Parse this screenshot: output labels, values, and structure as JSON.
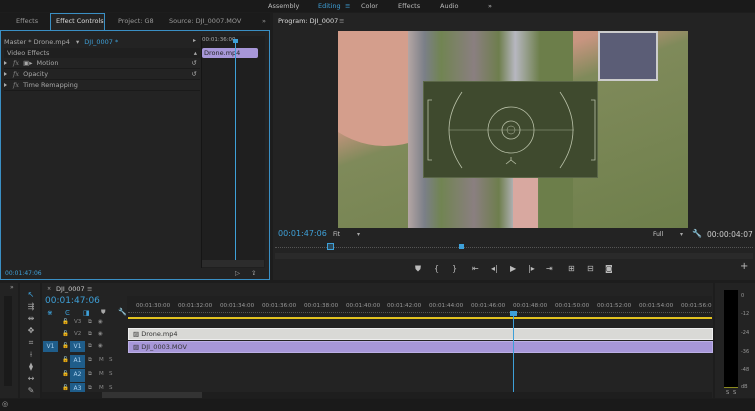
{
  "workspaces": {
    "items": [
      "Assembly",
      "Editing",
      "Color",
      "Effects",
      "Audio"
    ],
    "active": "Editing",
    "more": "»"
  },
  "tabs": {
    "effects": "Effects",
    "effect_controls": "Effect Controls",
    "project": "Project: G8",
    "source": "Source: DJI_0007.MOV",
    "more": "»",
    "program": "Program: DJI_0007"
  },
  "effect_controls": {
    "master": "Master * Drone.mp4",
    "sequence_clip": "DJI_0007 * Drone.mp4",
    "mini_time": "00:01:36:00",
    "mini_clip": "Drone.mp4",
    "section": "Video Effects",
    "effects": [
      "Motion",
      "Opacity",
      "Time Remapping"
    ],
    "timecode": "00:01:47:06"
  },
  "program": {
    "timecode": "00:01:47:06",
    "zoom": "Fit",
    "resolution": "Full",
    "duration": "00:00:04:07"
  },
  "timeline": {
    "sequence": "DJI_0007",
    "timecode": "00:01:47:06",
    "ruler": [
      "00:01:30:00",
      "00:01:32:00",
      "00:01:34:00",
      "00:01:36:00",
      "00:01:38:00",
      "00:01:40:00",
      "00:01:42:00",
      "00:01:44:00",
      "00:01:46:00",
      "00:01:48:00",
      "00:01:50:00",
      "00:01:52:00",
      "00:01:54:00",
      "00:01:56:0"
    ],
    "tracks": [
      {
        "label": "V3",
        "m": "",
        "s": ""
      },
      {
        "label": "V2",
        "m": "",
        "s": ""
      },
      {
        "label": "V1",
        "source": "V1",
        "m": "",
        "s": ""
      },
      {
        "label": "A1",
        "m": "M",
        "s": "S"
      },
      {
        "label": "A2",
        "m": "M",
        "s": "S"
      },
      {
        "label": "A3",
        "m": "M",
        "s": "S"
      }
    ],
    "clips": {
      "v2": "Drone.mp4",
      "v1": "DJI_0003.MOV"
    }
  },
  "meter": {
    "scale": [
      "0",
      "-12",
      "-24",
      "-36",
      "-48",
      "dB"
    ],
    "solo": [
      "S",
      "S"
    ]
  },
  "colors": {
    "accent": "#3ea0d8",
    "clip_video": "#a797d9",
    "clip_graphic": "#d9d9d6",
    "work_area": "#e2c21f"
  }
}
